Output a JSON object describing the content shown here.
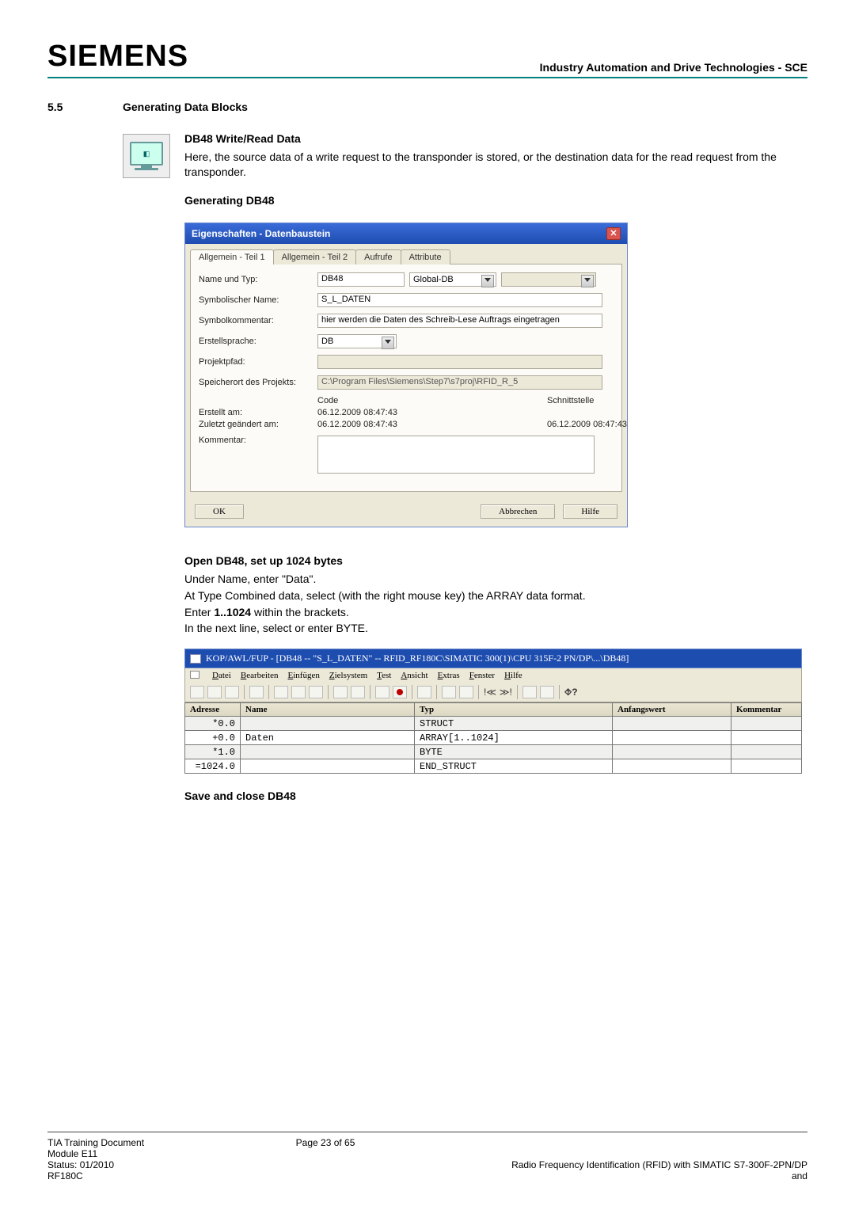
{
  "header": {
    "logo": "SIEMENS",
    "right": "Industry Automation and Drive Technologies - SCE"
  },
  "section": {
    "number": "5.5",
    "title": "Generating Data Blocks"
  },
  "db48": {
    "heading": "DB48 Write/Read Data",
    "para": "Here, the source data of a write request to the transponder is stored, or the destination data for the read request from the transponder.",
    "gen_heading": "Generating DB48"
  },
  "dialog": {
    "title": "Eigenschaften - Datenbaustein",
    "tabs": {
      "t1": "Allgemein - Teil 1",
      "t2": "Allgemein - Teil 2",
      "t3": "Aufrufe",
      "t4": "Attribute"
    },
    "labels": {
      "name_typ": "Name und Typ:",
      "sym_name": "Symbolischer Name:",
      "sym_komm": "Symbolkommentar:",
      "sprache": "Erstellsprache:",
      "pfad": "Projektpfad:",
      "speicher": "Speicherort des Projekts:",
      "code": "Code",
      "schnitt": "Schnittstelle",
      "erstellt": "Erstellt am:",
      "geaendert": "Zuletzt geändert am:",
      "kommentar": "Kommentar:"
    },
    "values": {
      "name": "DB48",
      "typ": "Global-DB",
      "sym_name": "S_L_DATEN",
      "sym_komm": "hier werden die Daten des Schreib-Lese Auftrags eingetragen",
      "sprache": "DB",
      "pfad": "",
      "speicher": "C:\\Program Files\\Siemens\\Step7\\s7proj\\RFID_R_5",
      "erstellt_code": "06.12.2009 08:47:43",
      "geaendert_code": "06.12.2009 08:47:43",
      "geaendert_sch": "06.12.2009 08:47:43"
    },
    "buttons": {
      "ok": "OK",
      "cancel": "Abbrechen",
      "help": "Hilfe"
    }
  },
  "setup": {
    "heading": "Open DB48, set up 1024 bytes",
    "l1": "Under Name, enter \"Data\".",
    "l2": "At Type Combined data, select (with the right mouse key) the ARRAY data format.",
    "l3_a": "Enter ",
    "l3_b": "1..1024",
    "l3_c": " within the brackets.",
    "l4": "In the next line, select or enter BYTE."
  },
  "editor": {
    "title": "KOP/AWL/FUP  - [DB48 -- \"S_L_DATEN\" -- RFID_RF180C\\SIMATIC 300(1)\\CPU 315F-2 PN/DP\\...\\DB48]",
    "menus": {
      "m1": "Datei",
      "m2": "Bearbeiten",
      "m3": "Einfügen",
      "m4": "Zielsystem",
      "m5": "Test",
      "m6": "Ansicht",
      "m7": "Extras",
      "m8": "Fenster",
      "m9": "Hilfe"
    },
    "cols": {
      "addr": "Adresse",
      "name": "Name",
      "typ": "Typ",
      "aw": "Anfangswert",
      "komm": "Kommentar"
    },
    "rows": [
      {
        "addr": "*0.0",
        "name": "",
        "typ": "STRUCT",
        "aw": "",
        "komm": ""
      },
      {
        "addr": "+0.0",
        "name": "Daten",
        "typ": "ARRAY[1..1024]",
        "aw": "",
        "komm": ""
      },
      {
        "addr": "*1.0",
        "name": "",
        "typ": "BYTE",
        "aw": "",
        "komm": ""
      },
      {
        "addr": "=1024.0",
        "name": "",
        "typ": "END_STRUCT",
        "aw": "",
        "komm": ""
      }
    ]
  },
  "save_close": "Save and close DB48",
  "footer": {
    "left1": "TIA Training Document",
    "left2": "Module E11",
    "left3": "Status: 01/2010",
    "left4": "RF180C",
    "center": "Page 23 of 65",
    "right": "Radio Frequency Identification (RFID) with SIMATIC S7-300F-2PN/DP and"
  }
}
